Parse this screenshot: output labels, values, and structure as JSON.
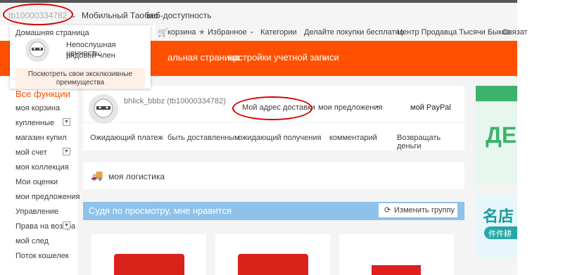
{
  "topbar": {
    "username": "tb10000334782",
    "mobile": "Мобильный Таобао",
    "web": "веб-доступность",
    "cart": "корзина",
    "favorites": "Избранное",
    "categories": "Категории",
    "free_shopping": "Делайте покупки бесплатно",
    "seller_center": "Центр Продавца Тысячи Быков",
    "contact": "Связат"
  },
  "user_dropdown": {
    "home": "Домашняя страница",
    "value_label": "Непослушная ценность:",
    "rank": "рядовой член",
    "exclusive": "Посмотреть свои эксклюзивные преимущества"
  },
  "main_nav": {
    "home": "альная страница",
    "account_settings": "настройки учетной записи"
  },
  "sidebar": {
    "title": "Все функции",
    "items": [
      {
        "label": "моя корзина"
      },
      {
        "label": "купленные"
      },
      {
        "label": "магазин купил"
      },
      {
        "label": "мой счет"
      },
      {
        "label": "моя коллекция"
      },
      {
        "label": "Мои оценки"
      },
      {
        "label": "мои предложения"
      },
      {
        "label": "Управление"
      },
      {
        "label": "Права на возвра"
      },
      {
        "label": "мой след"
      },
      {
        "label": "Поток кошелек"
      }
    ]
  },
  "profile": {
    "name": "bhlick_bbbz (tb10000334782)",
    "address": "Мой адрес доставки",
    "offers": "мои предложения",
    "paypal": "мой PayPal"
  },
  "order_tabs": [
    "Ожидающий платеж",
    "быть доставленным",
    "ожидающий получения",
    "комментарий",
    "Возвращать деньги"
  ],
  "logistics": "моя логистика",
  "recommend": {
    "title": "Судя по просмотру, мне нравится",
    "change": "Изменить",
    "group": "группу"
  },
  "ads": {
    "green_text": "ДЕ",
    "cn_title": "名店",
    "cn_sub": "件件耕"
  },
  "colors": {
    "accent": "#ff5000",
    "recommend_bar": "#8fc2ea",
    "highlight_red": "#d40000"
  }
}
